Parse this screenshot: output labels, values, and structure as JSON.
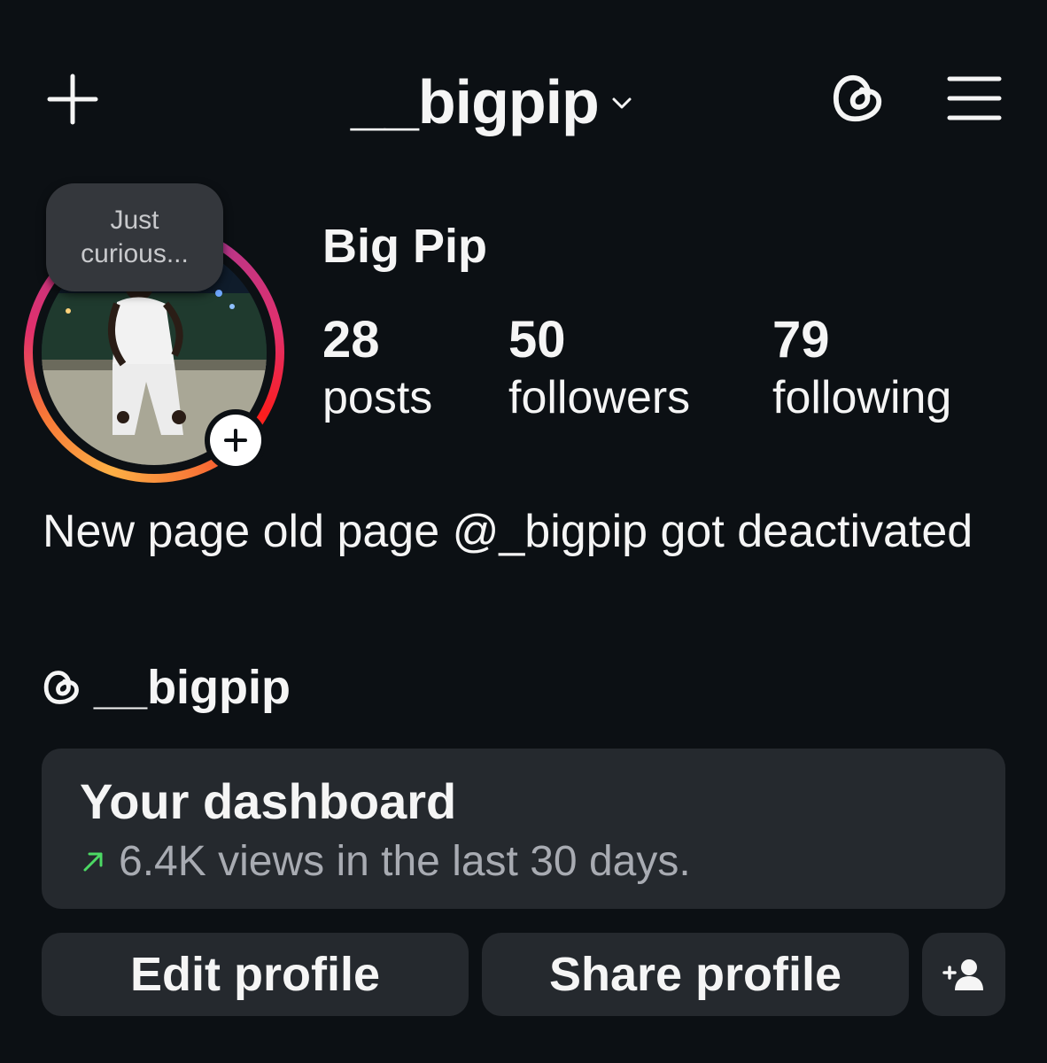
{
  "header": {
    "username": "__bigpip",
    "icons": [
      "plus-icon",
      "chevron-down-icon",
      "threads-icon",
      "menu-icon"
    ]
  },
  "note": {
    "line1": "Just",
    "line2": "curious..."
  },
  "profile": {
    "display_name": "Big Pip",
    "stats": {
      "posts_count": "28",
      "posts_label": "posts",
      "followers_count": "50",
      "followers_label": "followers",
      "following_count": "79",
      "following_label": "following"
    },
    "bio": "New page old page @_bigpip got deactivated",
    "threads_handle": "__bigpip"
  },
  "dashboard": {
    "title": "Your dashboard",
    "subtitle": "6.4K views in the last 30 days.",
    "trend_color": "#4cd964"
  },
  "actions": {
    "edit_label": "Edit profile",
    "share_label": "Share profile"
  },
  "colors": {
    "background": "#0c1014",
    "card": "#25292e",
    "text": "#f5f5f5",
    "muted_text": "#a8abb2"
  }
}
